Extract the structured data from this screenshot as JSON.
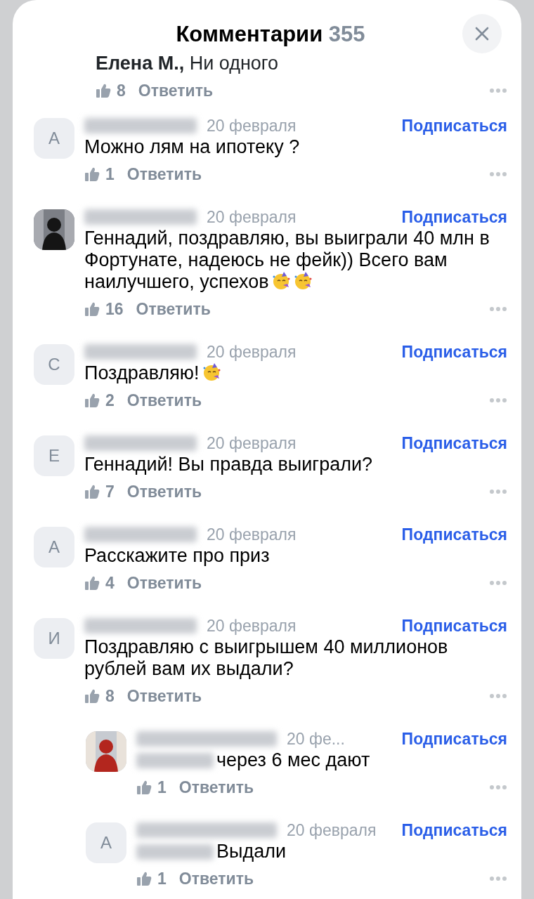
{
  "header": {
    "title": "Комментарии",
    "count": "355"
  },
  "partial_comment": {
    "text": "**Елена М.,** Ни одного",
    "likes": "8",
    "reply_label": "Ответить"
  },
  "comments": [
    {
      "avatar": {
        "kind": "letter",
        "letter": "А"
      },
      "date": "20 февраля",
      "subscribe": "Подписаться",
      "text": "Можно лям на ипотеку ?",
      "likes": "1",
      "reply_label": "Ответить"
    },
    {
      "date": "20 февраля",
      "subscribe": "Подписаться",
      "text": "Геннадий, поздравляю, вы выиграли 40 млн в Фортунате, надеюсь не фейк)) Всего вам наилучшего, успехов",
      "trailing_icons": [
        {
          "kind": "party-face"
        },
        {
          "kind": "party-face"
        }
      ],
      "likes": "16",
      "reply_label": "Ответить"
    },
    {
      "avatar": {
        "kind": "letter",
        "letter": "С"
      },
      "date": "20 февраля",
      "subscribe": "Подписаться",
      "text": "Поздравляю!",
      "trailing_icons": [
        {
          "kind": "party-face"
        }
      ],
      "likes": "2",
      "reply_label": "Ответить"
    },
    {
      "avatar": {
        "kind": "letter",
        "letter": "Е"
      },
      "date": "20 февраля",
      "subscribe": "Подписаться",
      "text": "Геннадий! Вы правда выиграли?",
      "likes": "7",
      "reply_label": "Ответить"
    },
    {
      "avatar": {
        "kind": "letter",
        "letter": "А"
      },
      "date": "20 февраля",
      "subscribe": "Подписаться",
      "text": "Расскажите про приз",
      "likes": "4",
      "reply_label": "Ответить"
    },
    {
      "avatar": {
        "kind": "letter",
        "letter": "И"
      },
      "date": "20 февраля",
      "subscribe": "Подписаться",
      "text": "Поздравляю с выигрышем 40 миллионов рублей вам их выдали?",
      "likes": "8",
      "reply_label": "Ответить",
      "replies": [
        {
          "date": "20 фе...",
          "subscribe": "Подписаться",
          "text": "через 6 мес дают",
          "likes": "1",
          "reply_label": "Ответить"
        },
        {
          "avatar": {
            "kind": "letter",
            "letter": "А"
          },
          "date": "20 февраля",
          "subscribe": "Подписаться",
          "text": "Выдали",
          "likes": "1",
          "reply_label": "Ответить"
        }
      ]
    }
  ]
}
